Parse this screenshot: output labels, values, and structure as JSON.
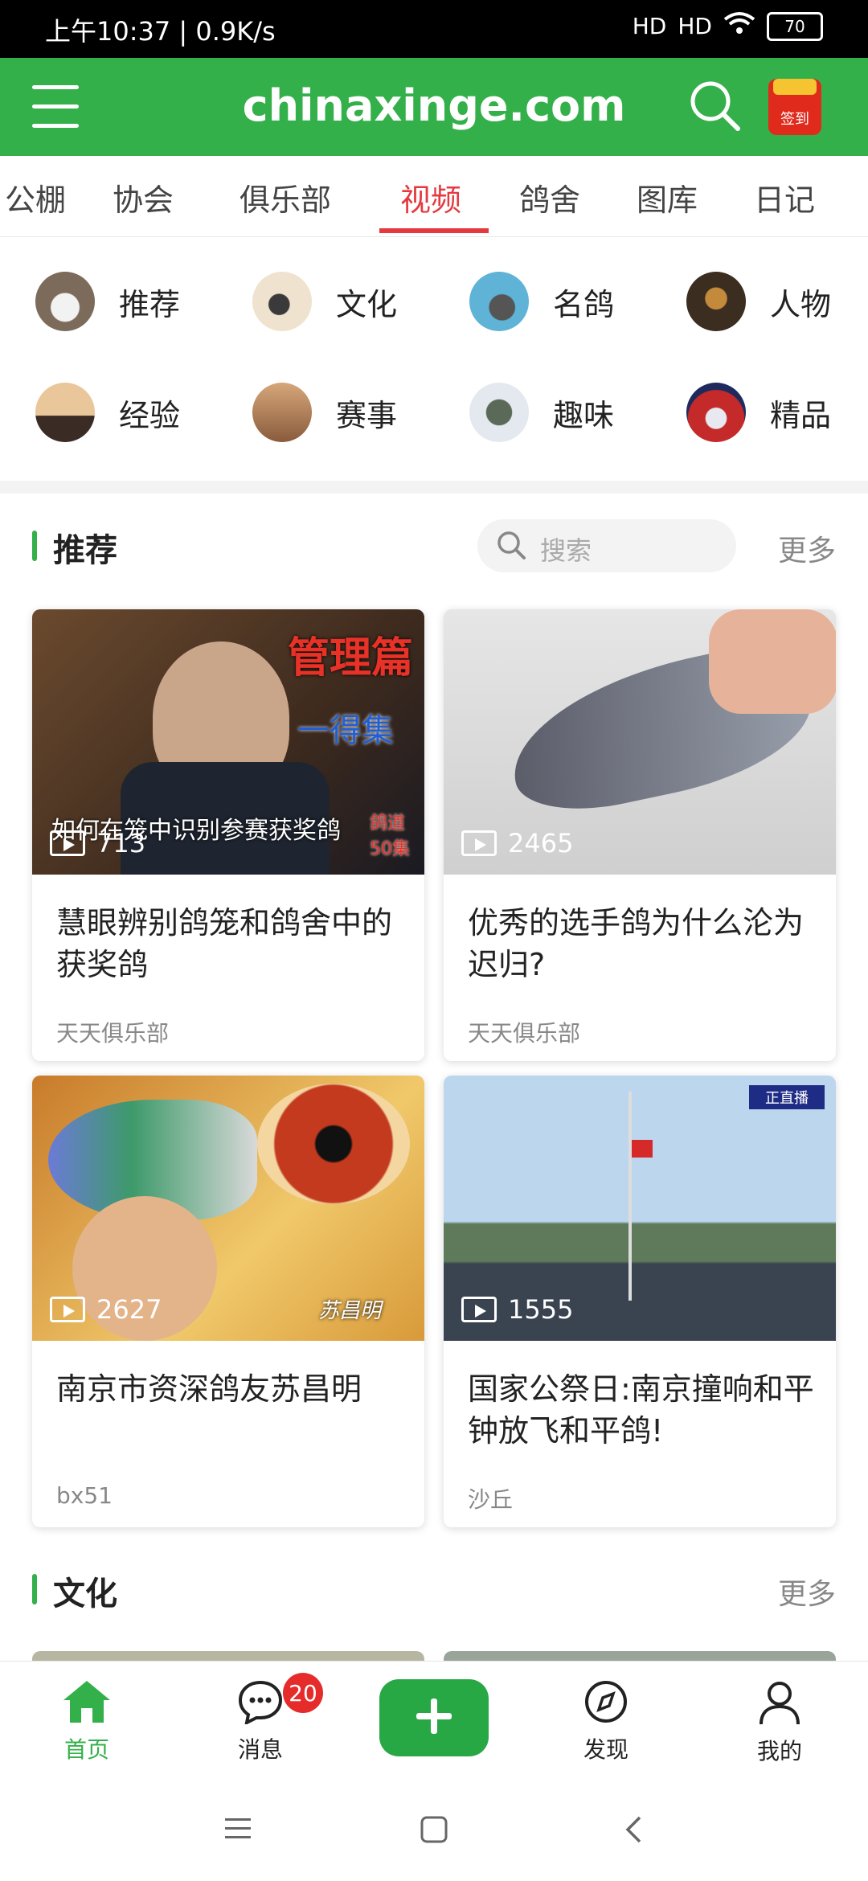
{
  "status_bar": {
    "time_speed": "上午10:37 | 0.9K/s",
    "signal1": "HD",
    "signal2": "HD",
    "battery": "70"
  },
  "app_bar": {
    "site_title": "chinaxinge.com",
    "checkin_label": "签到"
  },
  "tabs": [
    {
      "label": "公棚"
    },
    {
      "label": "协会"
    },
    {
      "label": "俱乐部"
    },
    {
      "label": "视频"
    },
    {
      "label": "鸽舍"
    },
    {
      "label": "图库"
    },
    {
      "label": "日记"
    }
  ],
  "categories": [
    {
      "label": "推荐"
    },
    {
      "label": "文化"
    },
    {
      "label": "名鸽"
    },
    {
      "label": "人物"
    },
    {
      "label": "经验"
    },
    {
      "label": "赛事"
    },
    {
      "label": "趣味"
    },
    {
      "label": "精品"
    }
  ],
  "section_recommend": {
    "title": "推荐",
    "search_placeholder": "搜索",
    "more": "更多"
  },
  "videos": [
    {
      "title": "慧眼辨别鸽笼和鸽舍中的获奖鸽",
      "author": "天天俱乐部",
      "views": "713",
      "overlay_main": "管理篇",
      "overlay_sub": "一得集",
      "overlay_caption": "如何在笼中识别参赛获奖鸽",
      "overlay_tag": "鸽道50集"
    },
    {
      "title": "优秀的选手鸽为什么沦为迟归?",
      "author": "天天俱乐部",
      "views": "2465"
    },
    {
      "title": "南京市资深鸽友苏昌明",
      "author": "bx51",
      "views": "2627",
      "overlay_sign": "苏昌明"
    },
    {
      "title": "国家公祭日:南京撞响和平钟放飞和平鸽!",
      "author": "沙丘",
      "views": "1555",
      "overlay_live": "正直播"
    }
  ],
  "section_culture": {
    "title": "文化",
    "more": "更多"
  },
  "bottom_nav": {
    "home": "首页",
    "messages": "消息",
    "messages_badge": "20",
    "discover": "发现",
    "mine": "我的"
  },
  "colors": {
    "brand_green": "#34b04a",
    "active_tab_red": "#e5393f",
    "badge_red": "#e62b2b"
  }
}
